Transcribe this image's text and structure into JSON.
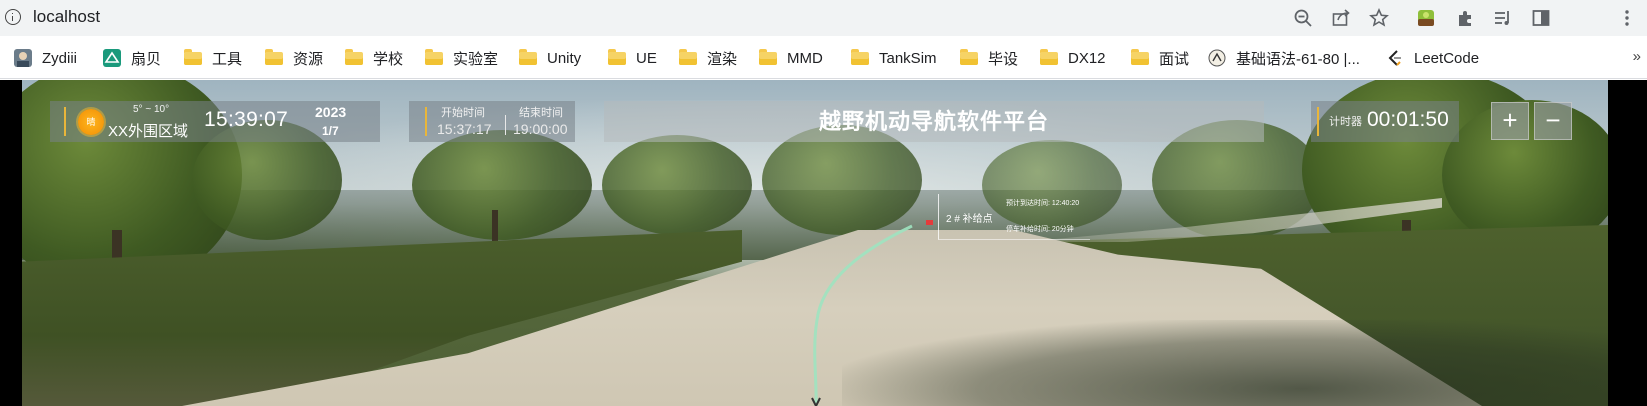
{
  "browser": {
    "url": "localhost",
    "toolbar_icons": [
      "zoom-out-icon",
      "share-icon",
      "bookmark-star-icon",
      "extension-avatar-icon",
      "extensions-puzzle-icon",
      "reading-list-icon",
      "side-panel-icon",
      "more-menu-icon"
    ]
  },
  "bookmarks": [
    {
      "label": "Zydiii",
      "icon": "avatar-icon"
    },
    {
      "label": "扇贝",
      "icon": "shanbay-icon"
    },
    {
      "label": "工具",
      "icon": "folder-icon"
    },
    {
      "label": "资源",
      "icon": "folder-icon"
    },
    {
      "label": "学校",
      "icon": "folder-icon"
    },
    {
      "label": "实验室",
      "icon": "folder-icon"
    },
    {
      "label": "Unity",
      "icon": "folder-icon"
    },
    {
      "label": "UE",
      "icon": "folder-icon"
    },
    {
      "label": "渲染",
      "icon": "folder-icon"
    },
    {
      "label": "MMD",
      "icon": "folder-icon"
    },
    {
      "label": "TankSim",
      "icon": "folder-icon"
    },
    {
      "label": "毕设",
      "icon": "folder-icon"
    },
    {
      "label": "DX12",
      "icon": "folder-icon"
    },
    {
      "label": "面试",
      "icon": "folder-icon"
    },
    {
      "label": "基础语法-61-80 |...",
      "icon": "site-icon"
    },
    {
      "label": "LeetCode",
      "icon": "leetcode-icon"
    }
  ],
  "bookmarks_more": "»",
  "hud": {
    "weather": {
      "icon_text": "晴",
      "temperature": "5° ~ 10°",
      "region": "XX外围区域",
      "time": "15:39:07",
      "year": "2023",
      "date": "1/7"
    },
    "schedule": {
      "start_label": "开始时间",
      "start_value": "15:37:17",
      "end_label": "结束时间",
      "end_value": "19:00:00"
    },
    "title": "越野机动导航软件平台",
    "timer": {
      "label": "计时器",
      "value": "00:01:50"
    },
    "zoom_in": "+",
    "zoom_out": "−"
  },
  "waypoint": {
    "name": "2 # 补给点",
    "eta": "预计到达时间: 12:40:20",
    "stop": "停车补给时间: 20分钟"
  },
  "colors": {
    "accent_divider": "#e9b63a",
    "route_line": "#9fe3c0",
    "waypoint_marker": "#e53b3b"
  }
}
